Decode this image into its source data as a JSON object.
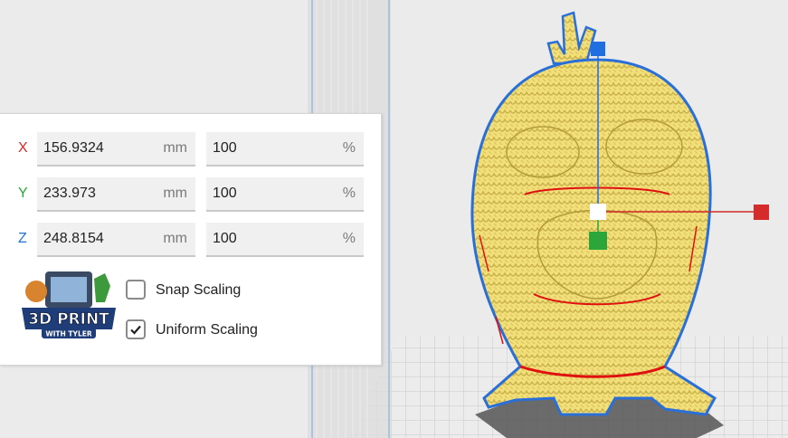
{
  "scale_panel": {
    "rows": [
      {
        "axis": "X",
        "axis_color": "#d52b2b",
        "size": "156.9324",
        "size_unit": "mm",
        "percent": "100",
        "percent_unit": "%"
      },
      {
        "axis": "Y",
        "axis_color": "#2ca53b",
        "size": "233.973",
        "size_unit": "mm",
        "percent": "100",
        "percent_unit": "%"
      },
      {
        "axis": "Z",
        "axis_color": "#2870d6",
        "size": "248.8154",
        "size_unit": "mm",
        "percent": "100",
        "percent_unit": "%"
      }
    ],
    "snap_scaling": {
      "label": "Snap Scaling",
      "checked": false
    },
    "uniform_scaling": {
      "label": "Uniform Scaling",
      "checked": true
    },
    "logo": {
      "line1": "3D PRINT",
      "line2": "WITH TYLER"
    }
  },
  "viewport": {
    "model_color": "#f2df7a",
    "model_outline_color": "#2a6fd8",
    "overhang_color": "#e01010",
    "gizmo": {
      "x_color": "#d52b2b",
      "y_color": "#2ca53b",
      "z_color": "#1f6fe0",
      "center_color": "#ffffff"
    }
  }
}
